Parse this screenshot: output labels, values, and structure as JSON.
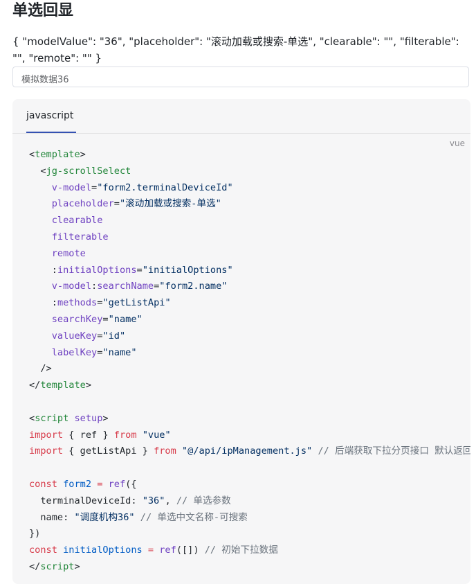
{
  "page": {
    "title": "单选回显",
    "props_text": "{ \"modelValue\": \"36\", \"placeholder\": \"滚动加载或搜索-单选\", \"clearable\": \"\", \"filterable\": \"\", \"remote\": \"\" }"
  },
  "select": {
    "value": "模拟数据36"
  },
  "code_panel": {
    "tab_label": "javascript",
    "lang_label": "vue",
    "lines": [
      [
        [
          "<",
          ""
        ],
        [
          "template",
          "t"
        ],
        [
          ">",
          ""
        ]
      ],
      [
        [
          "  <",
          ""
        ],
        [
          "jg-scrollSelect",
          "t"
        ]
      ],
      [
        [
          "    ",
          ""
        ],
        [
          "v-model",
          "a"
        ],
        [
          "=",
          ""
        ],
        [
          "\"form2.terminalDeviceId\"",
          "s"
        ]
      ],
      [
        [
          "    ",
          ""
        ],
        [
          "placeholder",
          "a"
        ],
        [
          "=",
          ""
        ],
        [
          "\"滚动加载或搜索-单选\"",
          "s"
        ]
      ],
      [
        [
          "    ",
          ""
        ],
        [
          "clearable",
          "a"
        ]
      ],
      [
        [
          "    ",
          ""
        ],
        [
          "filterable",
          "a"
        ]
      ],
      [
        [
          "    ",
          ""
        ],
        [
          "remote",
          "a"
        ]
      ],
      [
        [
          "    ",
          ""
        ],
        [
          ":",
          ""
        ],
        [
          "initialOptions",
          "a"
        ],
        [
          "=",
          ""
        ],
        [
          "\"initialOptions\"",
          "s"
        ]
      ],
      [
        [
          "    ",
          ""
        ],
        [
          "v-model",
          "a"
        ],
        [
          ":",
          ""
        ],
        [
          "searchName",
          "a"
        ],
        [
          "=",
          ""
        ],
        [
          "\"form2.name\"",
          "s"
        ]
      ],
      [
        [
          "    ",
          ""
        ],
        [
          ":",
          ""
        ],
        [
          "methods",
          "a"
        ],
        [
          "=",
          ""
        ],
        [
          "\"getListApi\"",
          "s"
        ]
      ],
      [
        [
          "    ",
          ""
        ],
        [
          "searchKey",
          "a"
        ],
        [
          "=",
          ""
        ],
        [
          "\"name\"",
          "s"
        ]
      ],
      [
        [
          "    ",
          ""
        ],
        [
          "valueKey",
          "a"
        ],
        [
          "=",
          ""
        ],
        [
          "\"id\"",
          "s"
        ]
      ],
      [
        [
          "    ",
          ""
        ],
        [
          "labelKey",
          "a"
        ],
        [
          "=",
          ""
        ],
        [
          "\"name\"",
          "s"
        ]
      ],
      [
        [
          "  />",
          ""
        ]
      ],
      [
        [
          "</",
          ""
        ],
        [
          "template",
          "t"
        ],
        [
          ">",
          ""
        ]
      ],
      [
        [
          "",
          ""
        ]
      ],
      [
        [
          "<",
          ""
        ],
        [
          "script",
          "t"
        ],
        [
          " ",
          ""
        ],
        [
          "setup",
          "a"
        ],
        [
          ">",
          ""
        ]
      ],
      [
        [
          "import",
          "k"
        ],
        [
          " { ref } ",
          ""
        ],
        [
          "from",
          "k"
        ],
        [
          " ",
          ""
        ],
        [
          "\"vue\"",
          "s"
        ]
      ],
      [
        [
          "import",
          "k"
        ],
        [
          " { getListApi } ",
          ""
        ],
        [
          "from",
          "k"
        ],
        [
          " ",
          ""
        ],
        [
          "\"@/api/ipManagement.js\"",
          "s"
        ],
        [
          " ",
          ""
        ],
        [
          "// 后端获取下拉分页接口 默认返回",
          "c"
        ]
      ],
      [
        [
          "",
          ""
        ]
      ],
      [
        [
          "const",
          "k"
        ],
        [
          " ",
          ""
        ],
        [
          "form2",
          "v"
        ],
        [
          " ",
          ""
        ],
        [
          "=",
          "k"
        ],
        [
          " ",
          ""
        ],
        [
          "ref",
          "a"
        ],
        [
          "({",
          ""
        ]
      ],
      [
        [
          "  terminalDeviceId: ",
          ""
        ],
        [
          "\"36\"",
          "s"
        ],
        [
          ", ",
          ""
        ],
        [
          "// 单选参数",
          "c"
        ]
      ],
      [
        [
          "  name: ",
          ""
        ],
        [
          "\"调度机构36\"",
          "s"
        ],
        [
          " ",
          ""
        ],
        [
          "// 单选中文名称-可搜索",
          "c"
        ]
      ],
      [
        [
          "})",
          ""
        ]
      ],
      [
        [
          "const",
          "k"
        ],
        [
          " ",
          ""
        ],
        [
          "initialOptions",
          "v"
        ],
        [
          " ",
          ""
        ],
        [
          "=",
          "k"
        ],
        [
          " ",
          ""
        ],
        [
          "ref",
          "a"
        ],
        [
          "([]) ",
          ""
        ],
        [
          "// 初始下拉数据",
          "c"
        ]
      ],
      [
        [
          "</",
          ""
        ],
        [
          "script",
          "t"
        ],
        [
          ">",
          ""
        ]
      ]
    ]
  }
}
